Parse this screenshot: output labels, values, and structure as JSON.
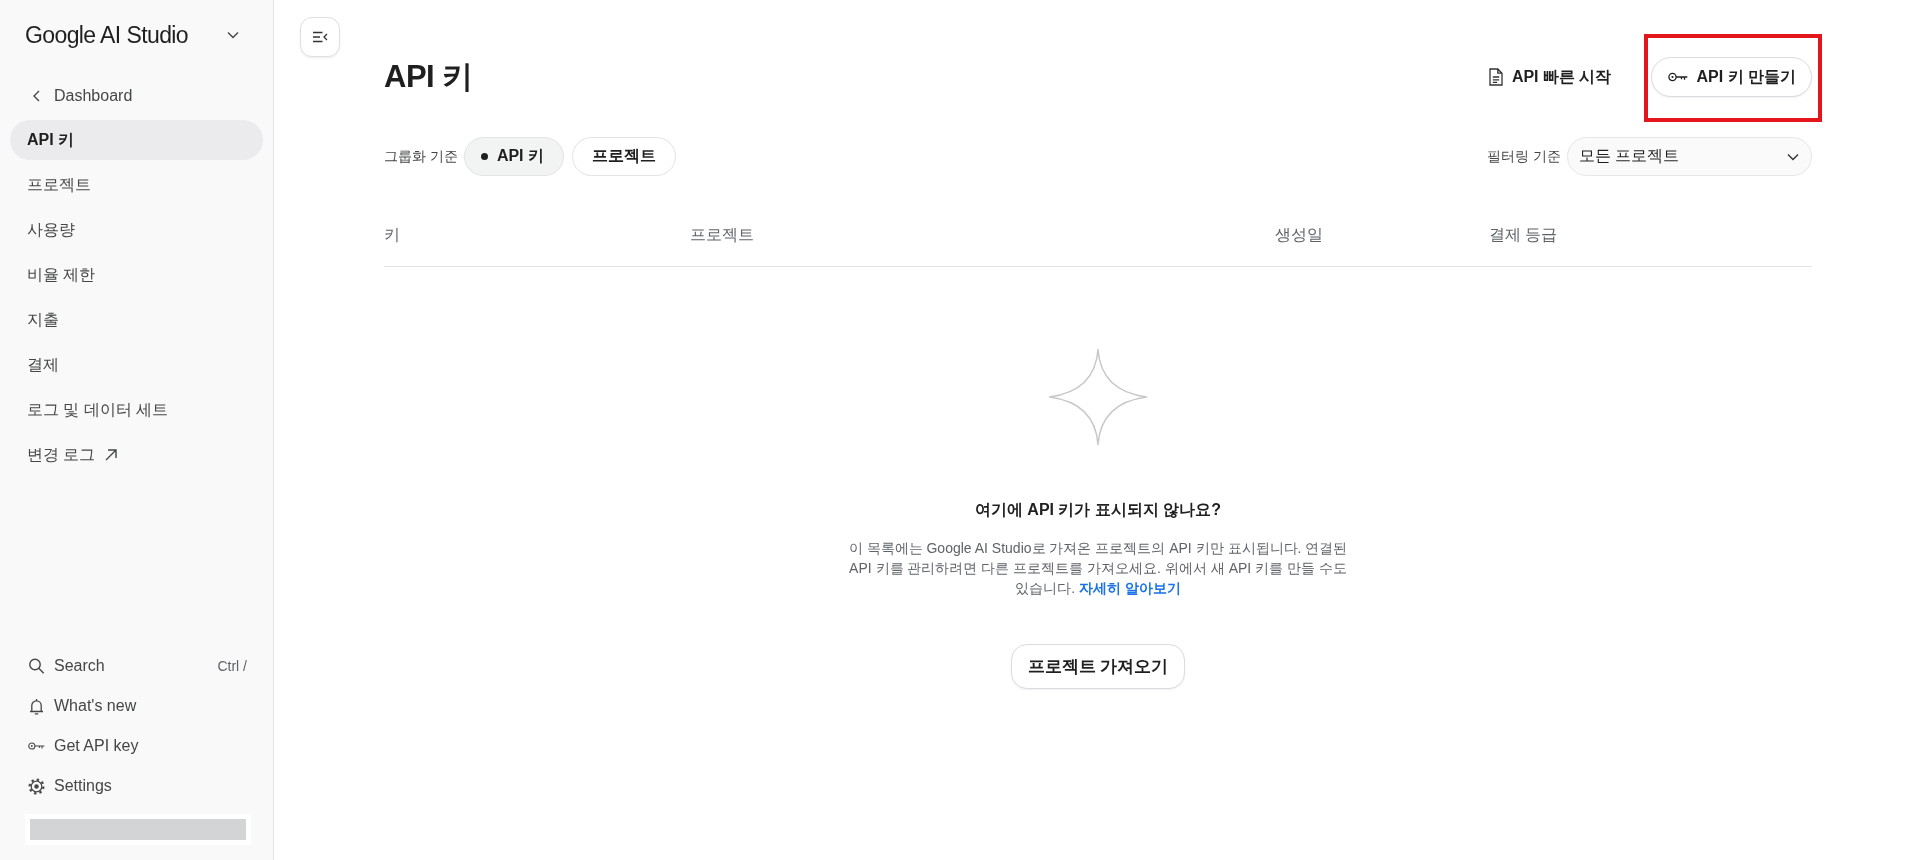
{
  "sidebar": {
    "brand": "Google AI Studio",
    "back_link": "Dashboard",
    "items": [
      {
        "label": "API 키",
        "selected": true,
        "external": false
      },
      {
        "label": "프로젝트",
        "selected": false,
        "external": false
      },
      {
        "label": "사용량",
        "selected": false,
        "external": false
      },
      {
        "label": "비율 제한",
        "selected": false,
        "external": false
      },
      {
        "label": "지출",
        "selected": false,
        "external": false
      },
      {
        "label": "결제",
        "selected": false,
        "external": false
      },
      {
        "label": "로그 및 데이터 세트",
        "selected": false,
        "external": false
      },
      {
        "label": "변경 로그",
        "selected": false,
        "external": true
      }
    ],
    "footer_items": [
      {
        "kind": "search",
        "label": "Search",
        "shortcut": "Ctrl /"
      },
      {
        "kind": "bell",
        "label": "What's new"
      },
      {
        "kind": "key",
        "label": "Get API key"
      },
      {
        "kind": "settings",
        "label": "Settings"
      }
    ]
  },
  "page": {
    "title": "API 키",
    "quickstart_link": "API 빠른 시작",
    "create_button": {
      "label": "API 키 만들기",
      "highlighted": true
    }
  },
  "group_by": {
    "label": "그룹화 기준",
    "options": [
      {
        "label": "API 키",
        "selected": true
      },
      {
        "label": "프로젝트",
        "selected": false
      }
    ]
  },
  "filter": {
    "label": "필터링 기준",
    "value": "모든 프로젝트"
  },
  "table": {
    "columns": [
      "키",
      "프로젝트",
      "생성일",
      "결제 등급"
    ]
  },
  "empty_state": {
    "title": "여기에 API 키가 표시되지 않나요?",
    "text": "이 목록에는 Google AI Studio로 가져온 프로젝트의 API 키만 표시됩니다. 연결된 API 키를 관리하려면 다른 프로젝트를 가져오세요. 위에서 새 API 키를 만들 수도 있습니다.",
    "link": "자세히 알아보기",
    "button": "프로젝트 가져오기"
  }
}
